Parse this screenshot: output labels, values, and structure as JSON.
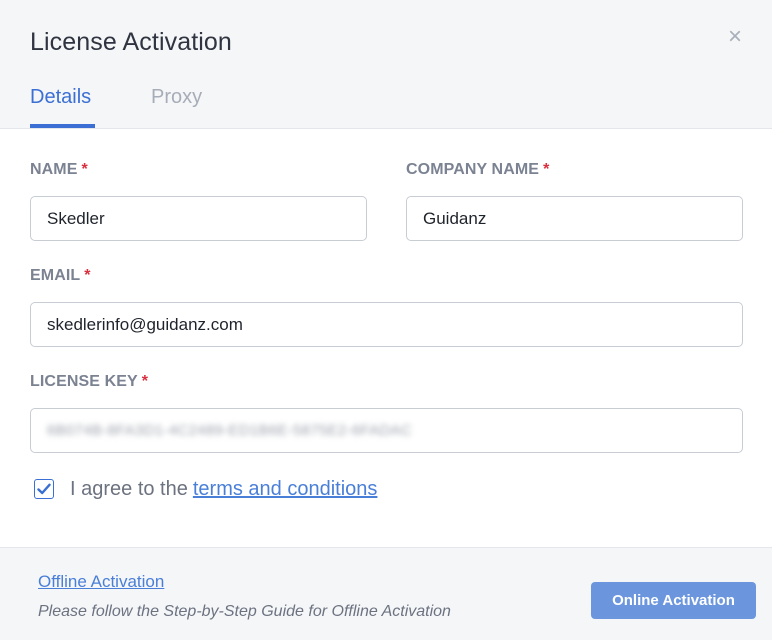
{
  "dialog": {
    "title": "License Activation",
    "close_glyph": "×"
  },
  "tabs": [
    {
      "label": "Details",
      "active": true
    },
    {
      "label": "Proxy",
      "active": false
    }
  ],
  "form": {
    "required_mark": "*",
    "name": {
      "label": "NAME",
      "value": "Skedler"
    },
    "company": {
      "label": "COMPANY NAME",
      "value": "Guidanz"
    },
    "email": {
      "label": "EMAIL",
      "value": "skedlerinfo@guidanz.com"
    },
    "license_key": {
      "label": "LICENSE KEY",
      "value": "6B074B-8FA3D1-4C2489-ED1B6E-5875E2-6FADAC",
      "obscured": true
    },
    "agree": {
      "checked": true,
      "prefix": "I agree to the",
      "link_text": "terms and conditions"
    }
  },
  "footer": {
    "offline_link": "Offline Activation",
    "hint": "Please follow the Step-by-Step Guide for Offline Activation",
    "online_button": "Online Activation"
  },
  "colors": {
    "accent": "#3b6fd4",
    "button": "#6b96de",
    "required": "#d9303f",
    "header_bg": "#f5f6f8"
  },
  "icons": {
    "close": "close-icon",
    "check": "checkmark-icon"
  }
}
